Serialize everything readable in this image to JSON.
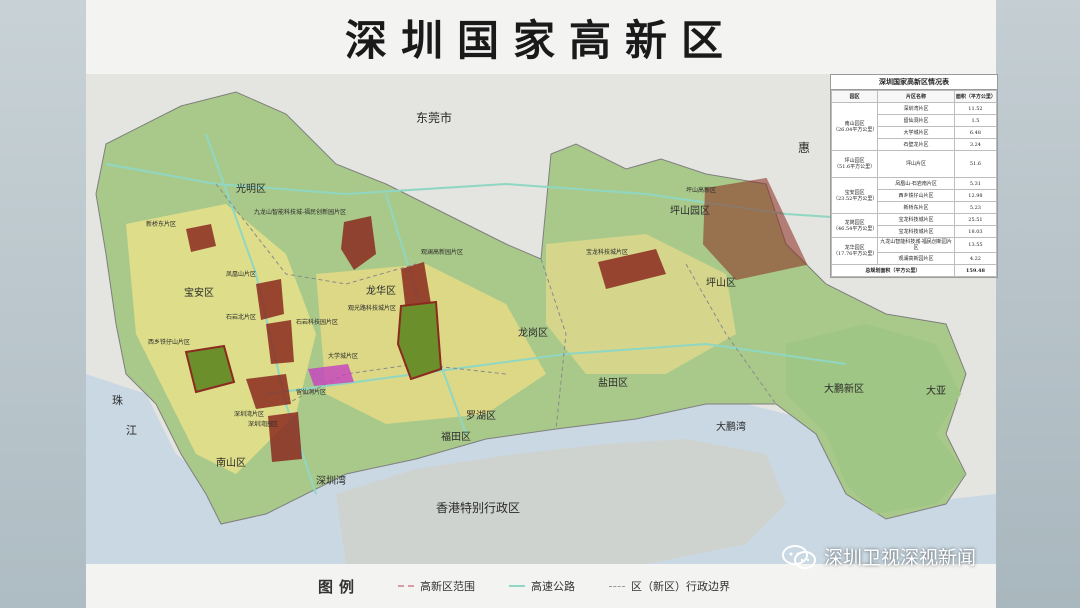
{
  "title": "深圳国家高新区",
  "map": {
    "place_labels": {
      "dongguan": "东莞市",
      "huizhou": "惠",
      "guangming": "光明区",
      "baoan": "宝安区",
      "longhua": "龙华区",
      "longgang": "龙岗区",
      "pingshan_top": "坪山园区",
      "pingshan": "坪山区",
      "nanshan": "南山区",
      "futian": "福田区",
      "luohu": "罗湖区",
      "yantian": "盐田区",
      "dapeng": "大鹏新区",
      "hongkong": "香港特别行政区",
      "zhujiang": "珠",
      "jiang": "江",
      "shenzhenwan": "深圳湾",
      "dapengwan": "大鹏湾",
      "daya": "大亚"
    },
    "park_labels": {
      "xili": "新桥东片区",
      "fenghuang": "凤凰山片区",
      "jiulong": "九龙山智能科技城-福民创新园片区",
      "guanlan": "观澜高新园片区",
      "qiaotou": "石岩科技园片区",
      "shiyan": "石岩北片区",
      "longhua_tech": "观光路科技城片区",
      "xixiang": "西乡铁仔山片区",
      "liuxian": "深圳湾片区",
      "daxuecheng": "大学城片区",
      "liuxiandong": "留仙洞片区",
      "nanshan_park": "深圳湾园区",
      "baolong": "宝龙科技城片区",
      "pingshan_park": "坪山高新区"
    }
  },
  "table": {
    "title": "深圳国家高新区情况表",
    "headers": [
      "园区",
      "片区名称",
      "面积（平方公里）"
    ],
    "groups": [
      {
        "park": "南山园区",
        "area": "（26.04平方公里）",
        "rows": [
          [
            "深圳湾片区",
            "11.52"
          ],
          [
            "留仙洞片区",
            "1.5"
          ],
          [
            "大学城片区",
            "6.48"
          ],
          [
            "石壁龙片区",
            "3.24"
          ]
        ]
      },
      {
        "park": "坪山园区",
        "area": "（51.6平方公里）",
        "rows": [
          [
            "坪山片区",
            "51.6"
          ]
        ]
      },
      {
        "park": "宝安园区",
        "area": "（23.52平方公里）",
        "rows": [
          [
            "凤凰山-石岩南片区",
            "5.31"
          ],
          [
            "西乡铁仔山片区",
            "12.98"
          ],
          [
            "新桥东片区",
            "5.23"
          ]
        ]
      },
      {
        "park": "龙岗园区",
        "area": "（46.54平方公里）",
        "rows": [
          [
            "宝龙科技城片区",
            "25.51"
          ],
          [
            "宝龙科技城片区",
            "18.03"
          ]
        ]
      },
      {
        "park": "龙华园区",
        "area": "（17.76平方公里）",
        "rows": [
          [
            "九龙山智能科技城-福民创新园片区",
            "13.55"
          ],
          [
            "观澜高新园片区",
            "4.22"
          ]
        ]
      }
    ],
    "total_label": "总规划面积（平方公里）",
    "total_value": "159.48"
  },
  "legend": {
    "title": "图例",
    "items": [
      {
        "label": "高新区范围",
        "color": "#d99aa8",
        "style": "dashed"
      },
      {
        "label": "高速公路",
        "color": "#8fd7c2",
        "style": "solid"
      },
      {
        "label": "区（新区）行政边界",
        "color": "#9a9a9a",
        "style": "dashed"
      }
    ]
  },
  "watermark": "深圳卫视深视新闻",
  "colors": {
    "land": "#a9c98a",
    "urban": "#e6e08a",
    "sea": "#c9d8e2",
    "outside": "#e4e4e0",
    "park": "#8b2a1f"
  }
}
